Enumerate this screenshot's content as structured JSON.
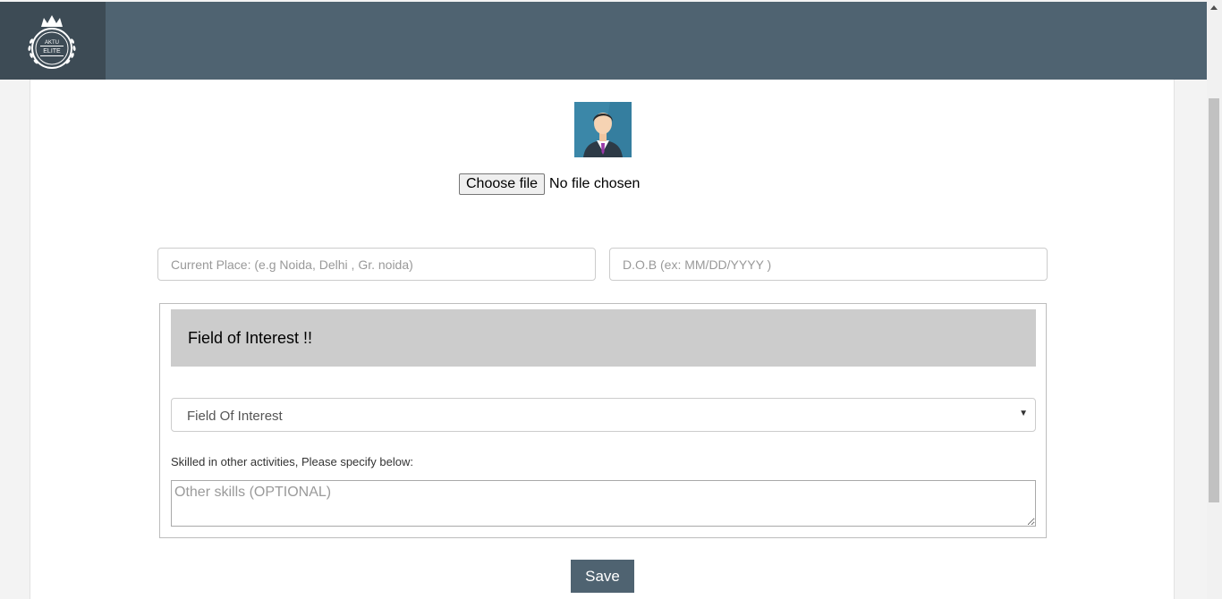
{
  "header": {
    "logo_text_top": "AKTU",
    "logo_text_bottom": "ELITE",
    "logo_icon": "crown-laurel-icon"
  },
  "profile": {
    "avatar_icon": "user-avatar-icon",
    "file_button_label": "Choose file",
    "file_status": "No file chosen"
  },
  "form": {
    "current_place_placeholder": "Current Place: (e.g Noida, Delhi , Gr. noida)",
    "dob_placeholder": "D.O.B (ex: MM/DD/YYYY )"
  },
  "interest": {
    "title": "Field of Interest !!",
    "select_value": "Field Of Interest",
    "skills_label": "Skilled in other activities, Please specify below:",
    "skills_placeholder": "Other skills (OPTIONAL)"
  },
  "actions": {
    "save_label": "Save"
  },
  "colors": {
    "header_bg": "#4f6371",
    "logo_bg": "#3d4b55",
    "panel_header_bg": "#cccccc",
    "save_bg": "#4f6371"
  }
}
